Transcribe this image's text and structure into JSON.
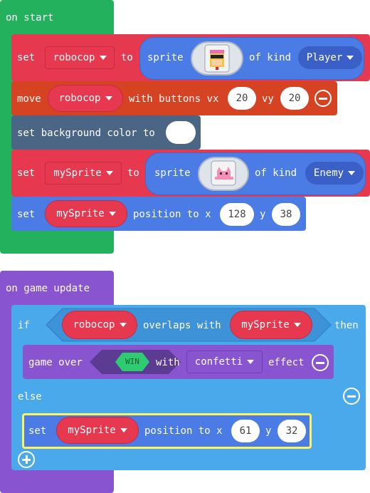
{
  "on_start": {
    "hat_label": "on start",
    "set1": {
      "set": "set",
      "var": "robocop",
      "to": "to",
      "sprite": "sprite",
      "of_kind": "of kind",
      "kind": "Player",
      "image": "robocop-sprite-icon"
    },
    "move": {
      "label": "move",
      "var": "robocop",
      "with_buttons": "with buttons vx",
      "vx": "20",
      "vy_label": "vy",
      "vy": "20"
    },
    "bg": {
      "label": "set background color to",
      "color": "#ffffff"
    },
    "set2": {
      "set": "set",
      "var": "mySprite",
      "to": "to",
      "sprite": "sprite",
      "of_kind": "of kind",
      "kind": "Enemy",
      "image": "pink-creature-sprite-icon"
    },
    "pos": {
      "set": "set",
      "var": "mySprite",
      "position_to_x": "position to x",
      "x": "128",
      "y_label": "y",
      "y": "38"
    }
  },
  "on_game_update": {
    "hat_label": "on game update",
    "if_label": "if",
    "cond": {
      "var1": "robocop",
      "overlaps": "overlaps with",
      "var2": "mySprite"
    },
    "then_label": "then",
    "game_over": {
      "label": "game over",
      "result": "WIN",
      "with": "with",
      "effect": "confetti",
      "effect_label": "effect"
    },
    "else_label": "else",
    "pos": {
      "set": "set",
      "var": "mySprite",
      "position_to_x": "position to x",
      "x": "61",
      "y_label": "y",
      "y": "32"
    }
  },
  "colors": {
    "events": "#24b15e",
    "sprites": "#e63950",
    "sprites_dark": "#c72a44",
    "controller": "#d54322",
    "scene": "#4b6584",
    "logic": "#4aa9eb",
    "game": "#8854d0",
    "sprite_reporter": "#4b7be5",
    "highlight": "#fff35c"
  }
}
